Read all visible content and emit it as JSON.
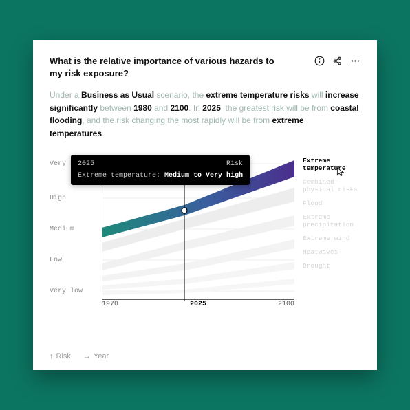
{
  "header": {
    "title": "What is the relative importance of various hazards to my risk exposure?"
  },
  "description": {
    "p1": "Under a ",
    "e1": "Business as Usual",
    "p2": " scenario, the ",
    "e2": "extreme temperature risks",
    "p3": " will ",
    "e3": "increase significantly",
    "p4": " between ",
    "e4": "1980",
    "p5": " and ",
    "e5": "2100",
    "p6": ". In ",
    "e6": "2025",
    "p7": ", the greatest risk will be from ",
    "e7": "coastal flooding",
    "p8": ", and the risk changing the most rapidly will be from ",
    "e8": "extreme temperatures",
    "p9": "."
  },
  "chart_data": {
    "type": "line",
    "xlabel": "Year",
    "ylabel": "Risk",
    "y_categories": [
      "Very low",
      "Low",
      "Medium",
      "High",
      "Very high"
    ],
    "x_range": [
      1970,
      2100
    ],
    "x_ticks": [
      1970,
      2025,
      2100
    ],
    "highlighted_x": 2025,
    "series": [
      {
        "name": "Extreme temperature",
        "highlighted": true,
        "points": [
          [
            1970,
            2.8
          ],
          [
            2025,
            3.6
          ],
          [
            2100,
            5.0
          ]
        ]
      },
      {
        "name": "Combined physical risks",
        "highlighted": false,
        "points": [
          [
            1970,
            2.5
          ],
          [
            2025,
            3.3
          ],
          [
            2100,
            4.3
          ]
        ]
      },
      {
        "name": "Flood",
        "highlighted": false,
        "points": [
          [
            1970,
            1.4
          ],
          [
            2025,
            2.6
          ],
          [
            2100,
            3.6
          ]
        ]
      },
      {
        "name": "Extreme precipitation",
        "highlighted": false,
        "points": [
          [
            1970,
            1.2
          ],
          [
            2025,
            2.2
          ],
          [
            2100,
            3.3
          ]
        ]
      },
      {
        "name": "Extreme wind",
        "highlighted": false,
        "points": [
          [
            1970,
            1.0
          ],
          [
            2025,
            1.5
          ],
          [
            2100,
            2.5
          ]
        ]
      },
      {
        "name": "Heatwaves",
        "highlighted": false,
        "points": [
          [
            1970,
            0.8
          ],
          [
            2025,
            1.2
          ],
          [
            2100,
            2.0
          ]
        ]
      },
      {
        "name": "Drought",
        "highlighted": false,
        "points": [
          [
            1970,
            0.5
          ],
          [
            2025,
            0.8
          ],
          [
            2100,
            1.4
          ]
        ]
      }
    ],
    "tooltip": {
      "year": "2025",
      "measure": "Risk",
      "series_label": "Extreme temperature:",
      "value": "Medium to Very high"
    }
  },
  "legend": {
    "items": [
      "Extreme temperature",
      "Combined physical risks",
      "Flood",
      "Extreme precipitation",
      "Extreme wind",
      "Heatwaves",
      "Drought"
    ]
  },
  "axis_hints": {
    "y": "Risk",
    "x": "Year"
  },
  "xticks": {
    "t0": "1970",
    "t1": "2025",
    "t2": "2100"
  },
  "yticks": {
    "y0": "Very high",
    "y1": "High",
    "y2": "Medium",
    "y3": "Low",
    "y4": "Very low"
  }
}
